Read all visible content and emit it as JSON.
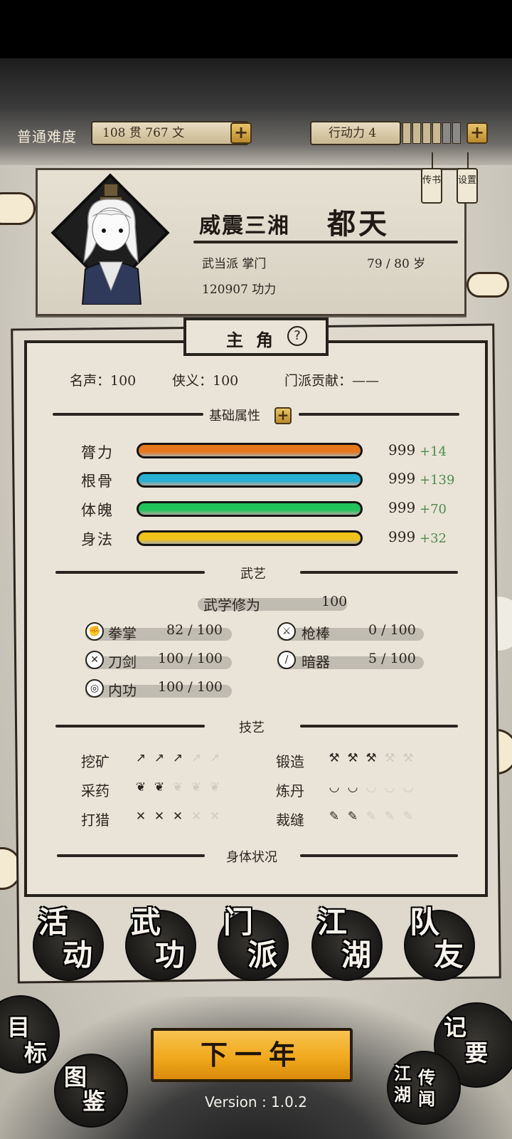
{
  "topbar": {
    "difficulty": "普通难度",
    "money": "108 贯  767 文",
    "action_points_label": "行动力 4",
    "action_points": 4,
    "action_points_max": 6
  },
  "profile": {
    "title": "威震三湘",
    "name": "都天",
    "sect_role": "武当派 掌门",
    "age": "79 / 80 岁",
    "power": "120907 功力",
    "letters_button": "传书",
    "settings_button": "设置"
  },
  "panel": {
    "tab_label": "主角",
    "help": "?",
    "fame": "名声：100",
    "chivalry": "侠义：100",
    "contribution": "门派贡献：——",
    "basic_attr_title": "基础属性",
    "attributes": [
      {
        "label": "膂力",
        "value": "999",
        "bonus": "+14",
        "color": "#e8771b"
      },
      {
        "label": "根骨",
        "value": "999",
        "bonus": "+139",
        "color": "#27b0d2"
      },
      {
        "label": "体魄",
        "value": "999",
        "bonus": "+70",
        "color": "#20c25b"
      },
      {
        "label": "身法",
        "value": "999",
        "bonus": "+32",
        "color": "#f0c21a"
      }
    ],
    "martial_title": "武艺",
    "martial_cultivation_label": "武学修为",
    "martial_cultivation_value": "100",
    "skills": [
      {
        "label": "拳掌",
        "value": "82 / 100",
        "icon": "fist-icon"
      },
      {
        "label": "枪棒",
        "value": "0 / 100",
        "icon": "spear-icon"
      },
      {
        "label": "刀剑",
        "value": "100 / 100",
        "icon": "swords-icon"
      },
      {
        "label": "暗器",
        "value": "5 / 100",
        "icon": "dart-icon"
      },
      {
        "label": "内功",
        "value": "100 / 100",
        "icon": "inner-power-icon"
      }
    ],
    "crafts_title": "技艺",
    "crafts": [
      {
        "label": "挖矿",
        "level": 3,
        "max": 5,
        "icon": "pickaxe-icon"
      },
      {
        "label": "锻造",
        "level": 3,
        "max": 5,
        "icon": "anvil-icon"
      },
      {
        "label": "采药",
        "level": 2,
        "max": 5,
        "icon": "herb-icon"
      },
      {
        "label": "炼丹",
        "level": 2,
        "max": 5,
        "icon": "bowl-icon"
      },
      {
        "label": "打猎",
        "level": 3,
        "max": 5,
        "icon": "bow-icon"
      },
      {
        "label": "裁缝",
        "level": 2,
        "max": 5,
        "icon": "needle-icon"
      }
    ],
    "body_title": "身体状况"
  },
  "nav": [
    {
      "top": "活",
      "bottom": "动"
    },
    {
      "top": "武",
      "bottom": "功"
    },
    {
      "top": "门",
      "bottom": "派"
    },
    {
      "top": "江",
      "bottom": "湖"
    },
    {
      "top": "队",
      "bottom": "友"
    }
  ],
  "corners": {
    "goal": [
      "目",
      "标"
    ],
    "codex": [
      "图",
      "鉴"
    ],
    "notes": [
      "记",
      "要"
    ],
    "legends": [
      "江",
      "湖",
      "传",
      "闻"
    ]
  },
  "next_year": "下一年",
  "version": "Version : 1.0.2"
}
